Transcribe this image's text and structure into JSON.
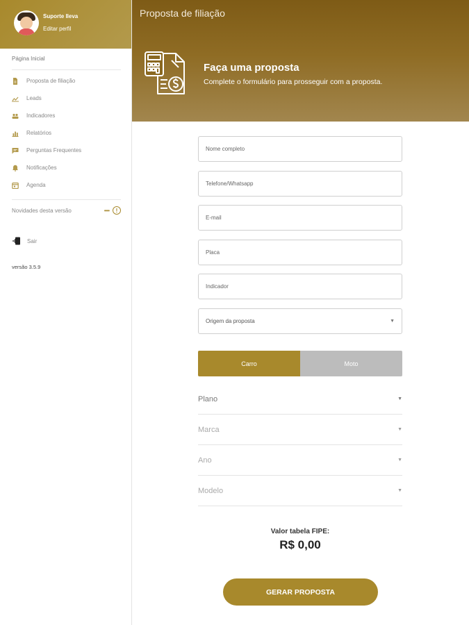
{
  "user": {
    "name": "Suporte Ileva",
    "edit_label": "Editar perfil"
  },
  "sidebar": {
    "home_label": "Página Inicial",
    "items": [
      {
        "label": "Proposta de filiação",
        "icon": "document-icon"
      },
      {
        "label": "Leads",
        "icon": "leads-icon"
      },
      {
        "label": "Indicadores",
        "icon": "people-icon"
      },
      {
        "label": "Relatórios",
        "icon": "bar-chart-icon"
      },
      {
        "label": "Perguntas Frequentes",
        "icon": "chat-icon"
      },
      {
        "label": "Notificações",
        "icon": "bell-icon"
      },
      {
        "label": "Agenda",
        "icon": "calendar-icon"
      }
    ],
    "news_label": "Novidades desta versão",
    "news_dots": "••••",
    "logout_label": "Sair",
    "version": "versão 3.5.9"
  },
  "header": {
    "title": "Proposta de filiação",
    "hero_title": "Faça uma proposta",
    "hero_subtitle": "Complete o formulário para prosseguir com a proposta."
  },
  "form": {
    "name_placeholder": "Nome completo",
    "phone_placeholder": "Telefone/Whatsapp",
    "email_placeholder": "E-mail",
    "plate_placeholder": "Placa",
    "referrer_placeholder": "Indicador",
    "origin_label": "Origem da proposta"
  },
  "vehicle_toggle": {
    "car": "Carro",
    "moto": "Moto",
    "selected": "Carro"
  },
  "dropdowns": {
    "plan": "Plano",
    "brand": "Marca",
    "year": "Ano",
    "model": "Modelo"
  },
  "fipe": {
    "label": "Valor tabela FIPE:",
    "value": "R$ 0,00"
  },
  "submit_label": "GERAR PROPOSTA",
  "colors": {
    "accent": "#a8892c",
    "header_dark": "#7e5b16",
    "toggle_off": "#bcbcbc"
  }
}
